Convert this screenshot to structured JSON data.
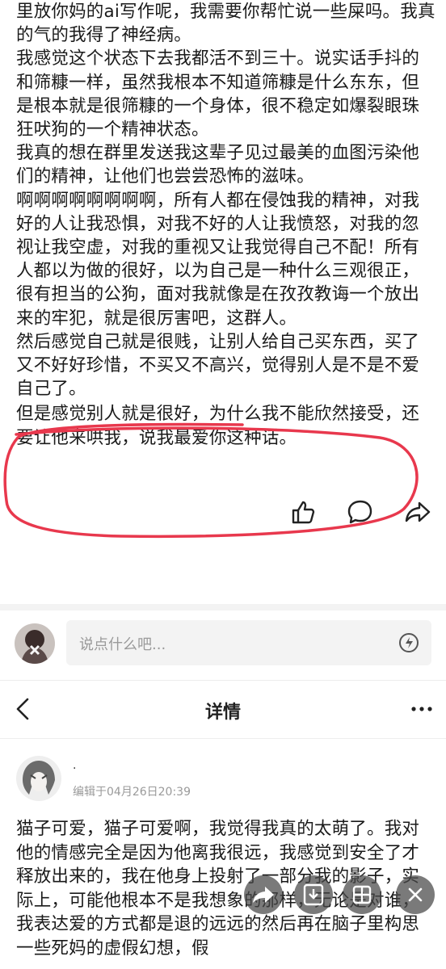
{
  "post": {
    "paragraphs": [
      "里放你妈的ai写作呢，我需要你帮忙说一些屎吗。我真的气的我得了神经病。",
      "我感觉这个状态下去我都活不到三十。说实话手抖的和筛糠一样，虽然我根本不知道筛糠是什么东东，但是根本就是很筛糠的一个身体，很不稳定如爆裂眼珠狂吠狗的一个精神状态。",
      "我真的想在群里发送我这辈子见过最美的血图污染他们的精神，让他们也尝尝恐怖的滋味。",
      "啊啊啊啊啊啊啊啊，所有人都在侵蚀我的精神，对我好的人让我恐惧，对我不好的人让我愤怒，对我的忽视让我空虚，对我的重视又让我觉得自己不配！所有人都以为做的很好，以为自己是一种什么三观很正，很有担当的公狗，面对我就像是在孜孜教诲一个放出来的牢犯，就是很厉害吧，这群人。",
      "然后感觉自己就是很贱，让别人给自己买东西，买了又不好好珍惜，不买又不高兴，觉得别人是不是不爱自己了。",
      "但是感觉别人就是很好，为什么我不能欣然接受，还要让他来哄我，说我最爱你这种话。"
    ],
    "actions": {
      "like_icon": "thumbs-up-icon",
      "comment_icon": "comment-bubble-icon",
      "share_icon": "share-arrow-icon"
    },
    "annotation_color": "#e8384d"
  },
  "comment_bar": {
    "placeholder": "说点什么吧..."
  },
  "nav": {
    "title": "详情"
  },
  "author": {
    "name": ".",
    "edit_info": "编辑于04月26日20:39"
  },
  "detail": {
    "paragraphs": [
      "猫子可爱，猫子可爱啊，我觉得我真的太萌了。我对他的情感完全是因为他离我很远，我感觉到安全了才释放出来的，我在他身上投射了一部分我的影子，实际上，可能他根本不是我想象的那样，无论是对谁，我表达爱的方式都是退的远远的然后再在脑子里构思一些死妈的虚假幻想，假"
    ]
  },
  "floating_buttons": [
    "share-icon",
    "download-icon",
    "grid-icon",
    "close-icon"
  ]
}
